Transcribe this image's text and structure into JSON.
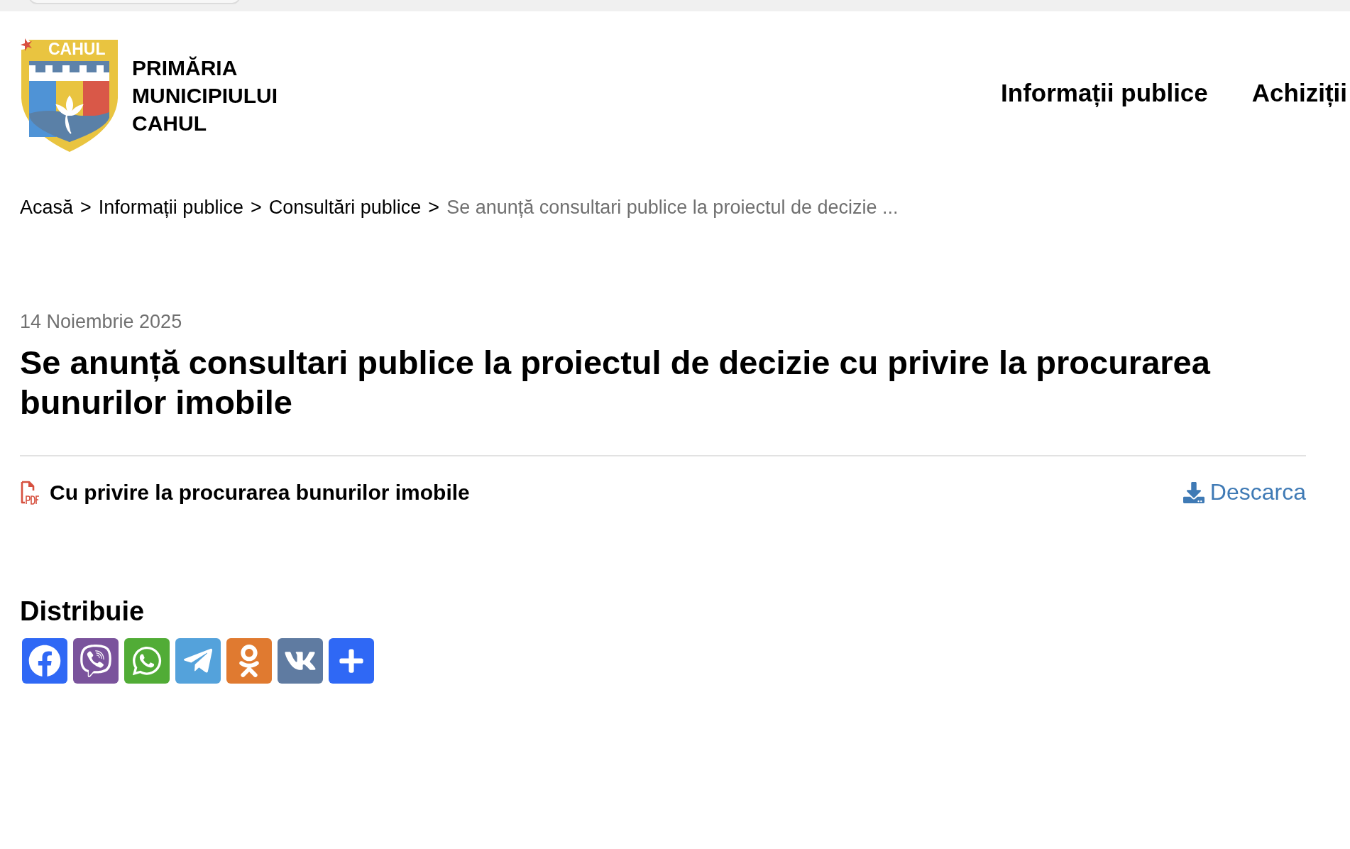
{
  "header": {
    "logo_badge": "CAHUL",
    "site_name": [
      "PRIMĂRIA",
      "MUNICIPIULUI",
      "CAHUL"
    ],
    "nav": [
      {
        "label": "Informații publice"
      },
      {
        "label": "Achiziții"
      }
    ]
  },
  "breadcrumb": [
    {
      "kind": "link",
      "text": "Acasă"
    },
    {
      "kind": "separator",
      "text": ">"
    },
    {
      "kind": "link",
      "text": "Informații publice"
    },
    {
      "kind": "separator",
      "text": ">"
    },
    {
      "kind": "link",
      "text": "Consultări publice"
    },
    {
      "kind": "separator",
      "text": ">"
    },
    {
      "kind": "current",
      "text": "Se anunță consultari publice la proiectul de decizie ..."
    }
  ],
  "article": {
    "date": "14 Noiembrie 2025",
    "title": "Se anunță consultari publice la proiectul de decizie cu privire la procurarea bunurilor imobile",
    "attachments": [
      {
        "name": "Cu privire la procurarea bunurilor imobile",
        "download": "Descarca"
      }
    ]
  },
  "share": {
    "heading": "Distribuie",
    "buttons": [
      {
        "kind": "facebook",
        "color": "#2f68f5"
      },
      {
        "kind": "viber",
        "color": "#7a539c"
      },
      {
        "kind": "whatsapp",
        "color": "#51ac36"
      },
      {
        "kind": "telegram",
        "color": "#54a2db"
      },
      {
        "kind": "odnoklassniki",
        "color": "#e07a30"
      },
      {
        "kind": "vk",
        "color": "#5f7ba1"
      },
      {
        "kind": "more",
        "color": "#2f68f5"
      }
    ]
  }
}
